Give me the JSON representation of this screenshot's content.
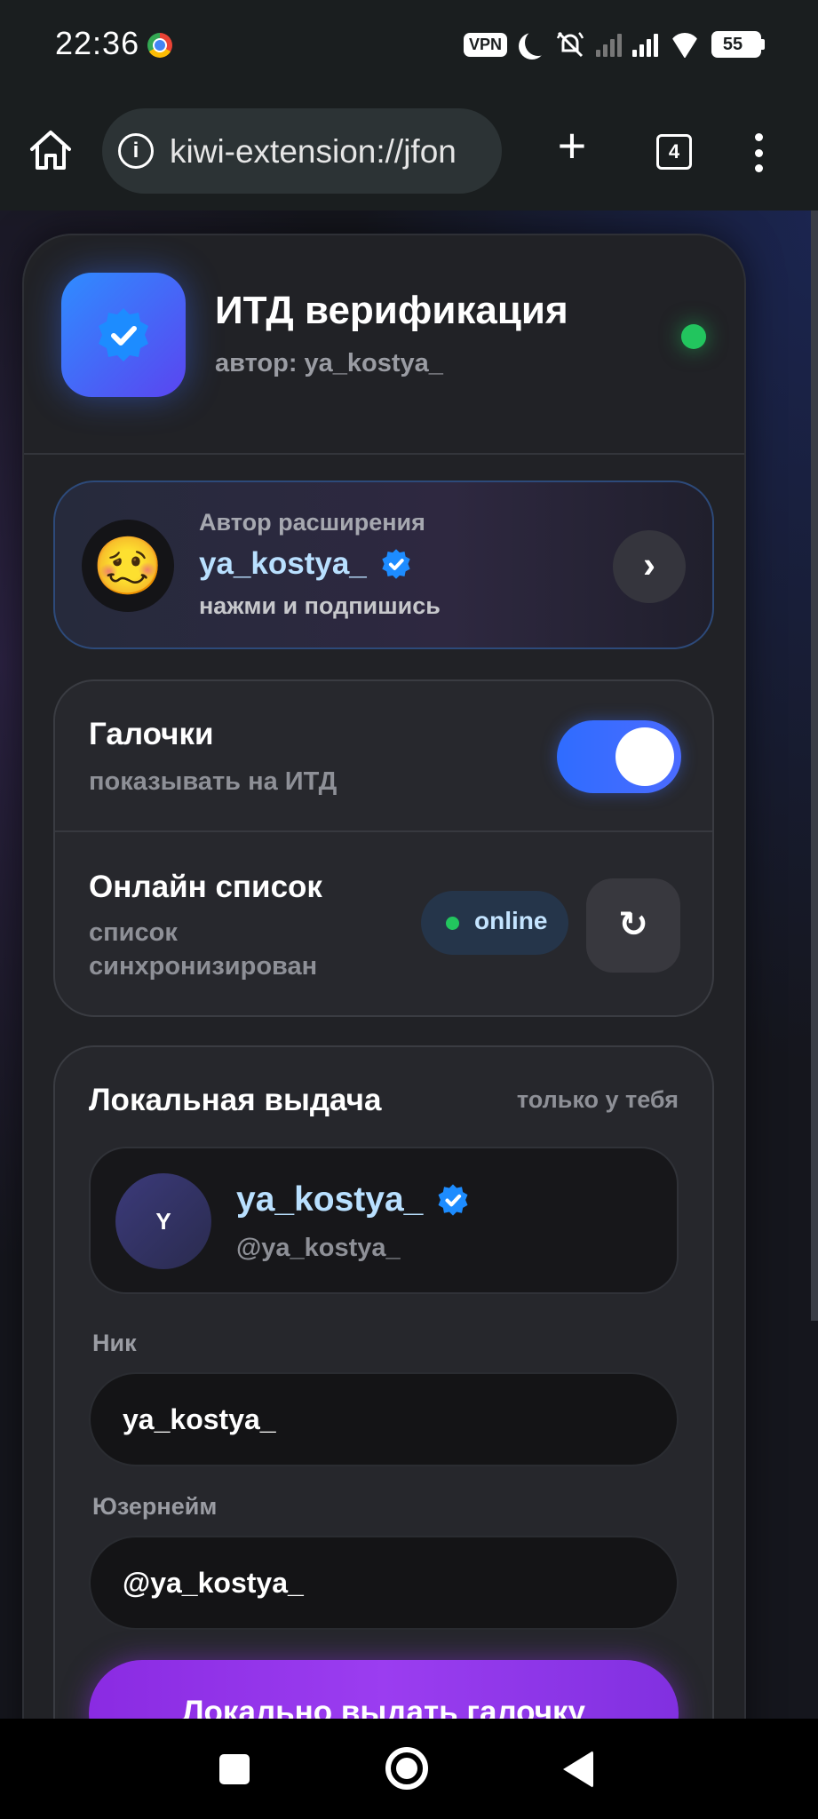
{
  "statusbar": {
    "time": "22:36",
    "vpn_label": "VPN",
    "battery": "55",
    "icons": [
      "chrome-icon",
      "moon-icon",
      "bell-off-icon",
      "signal-icon",
      "signal-icon",
      "wifi-icon",
      "battery-icon"
    ]
  },
  "browser": {
    "url": "kiwi-extension://jfon",
    "tab_count": "4",
    "icons": [
      "home-icon",
      "info-icon",
      "plus-icon",
      "tabs-icon",
      "menu-icon"
    ]
  },
  "header": {
    "title": "ИТД верификация",
    "subtitle": "автор: ya_kostya_",
    "status_color": "#22c55e"
  },
  "author": {
    "caption": "Автор расширения",
    "name": "ya_kostya_",
    "cta": "нажми и подпишись",
    "emoji": "🥴",
    "arrow": "›"
  },
  "settings": {
    "checkmarks": {
      "title": "Галочки",
      "subtitle": "показывать на ИТД",
      "enabled": true
    },
    "online_list": {
      "title": "Онлайн список",
      "subtitle_line1": "список",
      "subtitle_line2": "синхронизирован",
      "status": "online",
      "refresh_symbol": "↻"
    }
  },
  "local": {
    "title": "Локальная выдача",
    "hint": "только у тебя",
    "preview": {
      "avatar_letter": "Y",
      "name": "ya_kostya_",
      "handle": "@ya_kostya_"
    },
    "nick_label": "Ник",
    "nick_value": "ya_kostya_",
    "username_label": "Юзернейм",
    "username_value": "@ya_kostya_",
    "submit_label": "Локально выдать галочку"
  },
  "colors": {
    "accent_blue": "#2f6cff",
    "accent_purple": "#8a2be2",
    "name_blue": "#b9e0ff",
    "online_green": "#22c55e"
  }
}
